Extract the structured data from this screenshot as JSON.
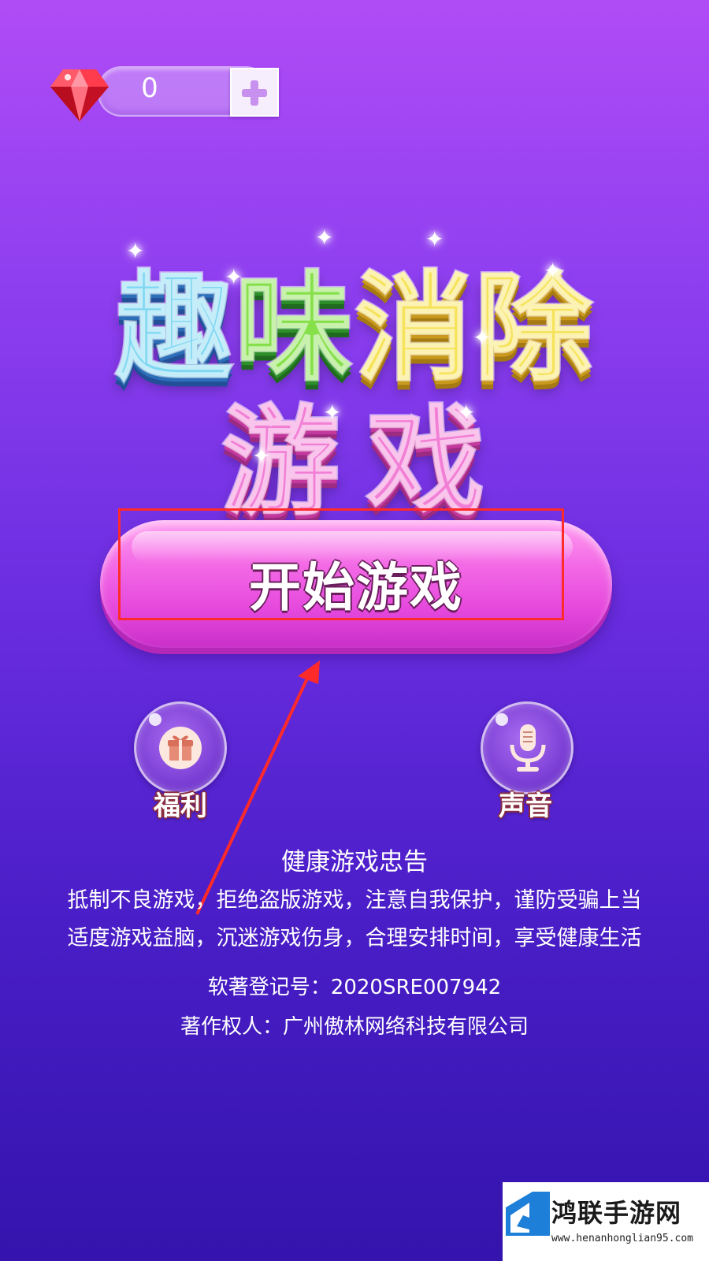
{
  "hud": {
    "gem_count": "0",
    "gem_icon": "ruby-gem-icon",
    "add_icon": "plus-icon"
  },
  "title": {
    "line1": [
      "趣",
      "味",
      "消",
      "除"
    ],
    "line2": [
      "游",
      "戏"
    ],
    "colors": {
      "cyan": "#7fd7f2",
      "green": "#86e04a",
      "yellow": "#f6e35a",
      "pink": "#f27fd6"
    }
  },
  "start_button": {
    "label": "开始游戏"
  },
  "side_buttons": {
    "welfare": {
      "label": "福利",
      "icon": "gift-icon"
    },
    "sound": {
      "label": "声音",
      "icon": "microphone-icon"
    }
  },
  "health_notice": {
    "title": "健康游戏忠告",
    "line1": "抵制不良游戏，拒绝盗版游戏，注意自我保护，谨防受骗上当",
    "line2": "适度游戏益脑，沉迷游戏伤身，合理安排时间，享受健康生活"
  },
  "copyright": {
    "registration": "软著登记号：2020SRE007942",
    "owner": "著作权人：广州傲林网络科技有限公司"
  },
  "watermark": {
    "name": "鸿联手游网",
    "url": "www.henanhonglian95.com"
  }
}
